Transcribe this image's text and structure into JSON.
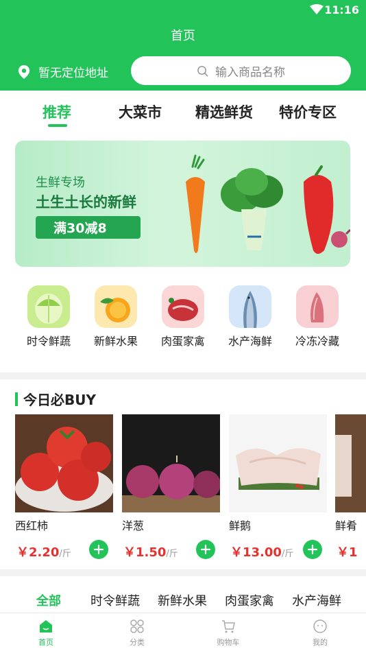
{
  "status": {
    "time": "11:16"
  },
  "header": {
    "title": "首页",
    "location": "暂无定位地址",
    "search_placeholder": "输入商品名称"
  },
  "tabs": [
    {
      "label": "推荐",
      "active": true
    },
    {
      "label": "大菜市",
      "active": false
    },
    {
      "label": "精选鲜货",
      "active": false
    },
    {
      "label": "特价专区",
      "active": false
    }
  ],
  "banner": {
    "subtitle": "生鲜专场",
    "title": "土生土长的新鲜",
    "button": "满30减8"
  },
  "categories": [
    {
      "label": "时令鲜蔬",
      "icon": "cabbage-icon"
    },
    {
      "label": "新鲜水果",
      "icon": "orange-icon"
    },
    {
      "label": "肉蛋家禽",
      "icon": "meat-icon"
    },
    {
      "label": "水产海鲜",
      "icon": "fish-icon"
    },
    {
      "label": "冷冻冷藏",
      "icon": "frozen-meat-icon"
    }
  ],
  "today": {
    "title": "今日必BUY",
    "products": [
      {
        "name": "西红柿",
        "price": "￥2.20",
        "unit": "/斤"
      },
      {
        "name": "洋葱",
        "price": "￥1.50",
        "unit": "/斤"
      },
      {
        "name": "鲜鹅",
        "price": "￥13.00",
        "unit": "/斤"
      },
      {
        "name": "鲜肴",
        "price": "￥1",
        "unit": ""
      }
    ]
  },
  "sub_tabs": [
    {
      "label": "全部",
      "active": true
    },
    {
      "label": "时令鲜蔬",
      "active": false
    },
    {
      "label": "新鲜水果",
      "active": false
    },
    {
      "label": "肉蛋家禽",
      "active": false
    },
    {
      "label": "水产海鲜",
      "active": false
    }
  ],
  "bottom_nav": [
    {
      "label": "首页",
      "icon": "home-icon",
      "active": true
    },
    {
      "label": "分类",
      "icon": "category-icon",
      "active": false
    },
    {
      "label": "购物车",
      "icon": "cart-icon",
      "active": false
    },
    {
      "label": "我的",
      "icon": "profile-icon",
      "active": false
    }
  ],
  "colors": {
    "brand": "#22c45a",
    "price": "#e8312f"
  }
}
